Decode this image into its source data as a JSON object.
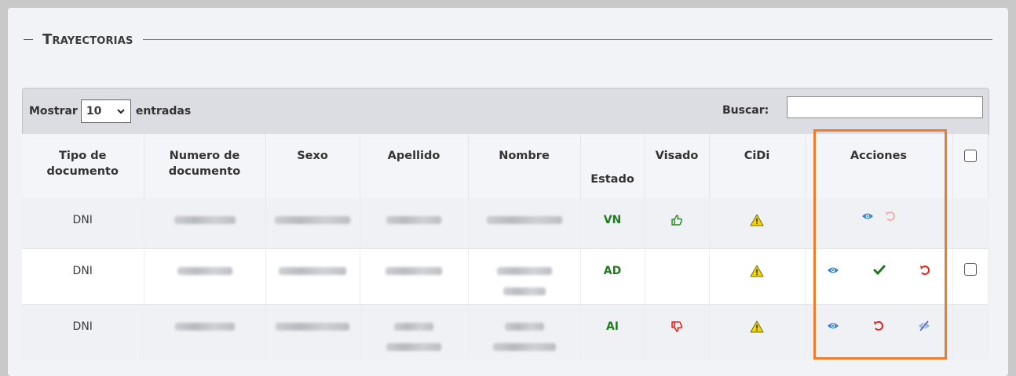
{
  "section": {
    "title": "Trayectorias"
  },
  "toolbar": {
    "show_label": "Mostrar",
    "page_size": "10",
    "entries_label": "entradas",
    "search_label": "Buscar:",
    "search_value": ""
  },
  "table": {
    "headers": {
      "doc_type": "Tipo de documento",
      "doc_number": "Numero de documento",
      "sex": "Sexo",
      "last_name": "Apellido",
      "first_name": "Nombre",
      "status": "Estado",
      "visado": "Visado",
      "cidi": "CiDi",
      "actions": "Acciones"
    },
    "rows": [
      {
        "doc_type": "DNI",
        "status": "VN",
        "visado": "thumbs-up-icon",
        "cidi": "warning-icon",
        "actions": [
          "view-icon",
          "undo-icon"
        ]
      },
      {
        "doc_type": "DNI",
        "status": "AD",
        "visado": "",
        "cidi": "warning-icon",
        "actions": [
          "view-icon",
          "check-icon",
          "undo-icon"
        ]
      },
      {
        "doc_type": "DNI",
        "status": "AI",
        "visado": "thumbs-down-icon",
        "cidi": "warning-icon",
        "actions": [
          "view-icon",
          "undo-icon",
          "hide-icon"
        ]
      }
    ]
  },
  "colors": {
    "accent_highlight": "#f07b2b",
    "status_green": "#1f7a1f",
    "danger_red": "#e8201c",
    "view_blue": "#3c87c8",
    "warning_yellow": "#f2d600"
  }
}
